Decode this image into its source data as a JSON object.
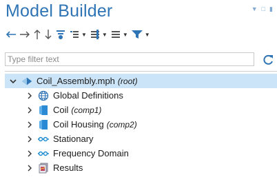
{
  "panel": {
    "title": "Model Builder"
  },
  "toolbar": {
    "buttons": [
      {
        "name": "back-arrow-icon"
      },
      {
        "name": "forward-arrow-icon"
      },
      {
        "name": "move-up-icon"
      },
      {
        "name": "move-down-icon"
      },
      {
        "name": "show-icon"
      },
      {
        "name": "collapse-icon"
      },
      {
        "name": "expand-icon"
      },
      {
        "name": "list-icon"
      },
      {
        "name": "funnel-icon"
      }
    ]
  },
  "filter": {
    "placeholder": "Type filter text",
    "value": ""
  },
  "tree": {
    "root": {
      "label": "Coil_Assembly.mph",
      "tag": "(root)",
      "icon": "model-diamond-icon"
    },
    "items": [
      {
        "label": "Global Definitions",
        "tag": "",
        "icon": "globe-icon"
      },
      {
        "label": "Coil",
        "tag": "(comp1)",
        "icon": "component-icon"
      },
      {
        "label": "Coil Housing",
        "tag": "(comp2)",
        "icon": "component-icon"
      },
      {
        "label": "Stationary",
        "tag": "",
        "icon": "study-icon"
      },
      {
        "label": "Frequency Domain",
        "tag": "",
        "icon": "study-icon"
      },
      {
        "label": "Results",
        "tag": "",
        "icon": "results-icon"
      }
    ]
  },
  "colors": {
    "title": "#2f74b5",
    "selection": "#cce4f7",
    "component": "#2a8ad4",
    "study": "#1a8bd0",
    "refresh": "#2f74b5"
  }
}
